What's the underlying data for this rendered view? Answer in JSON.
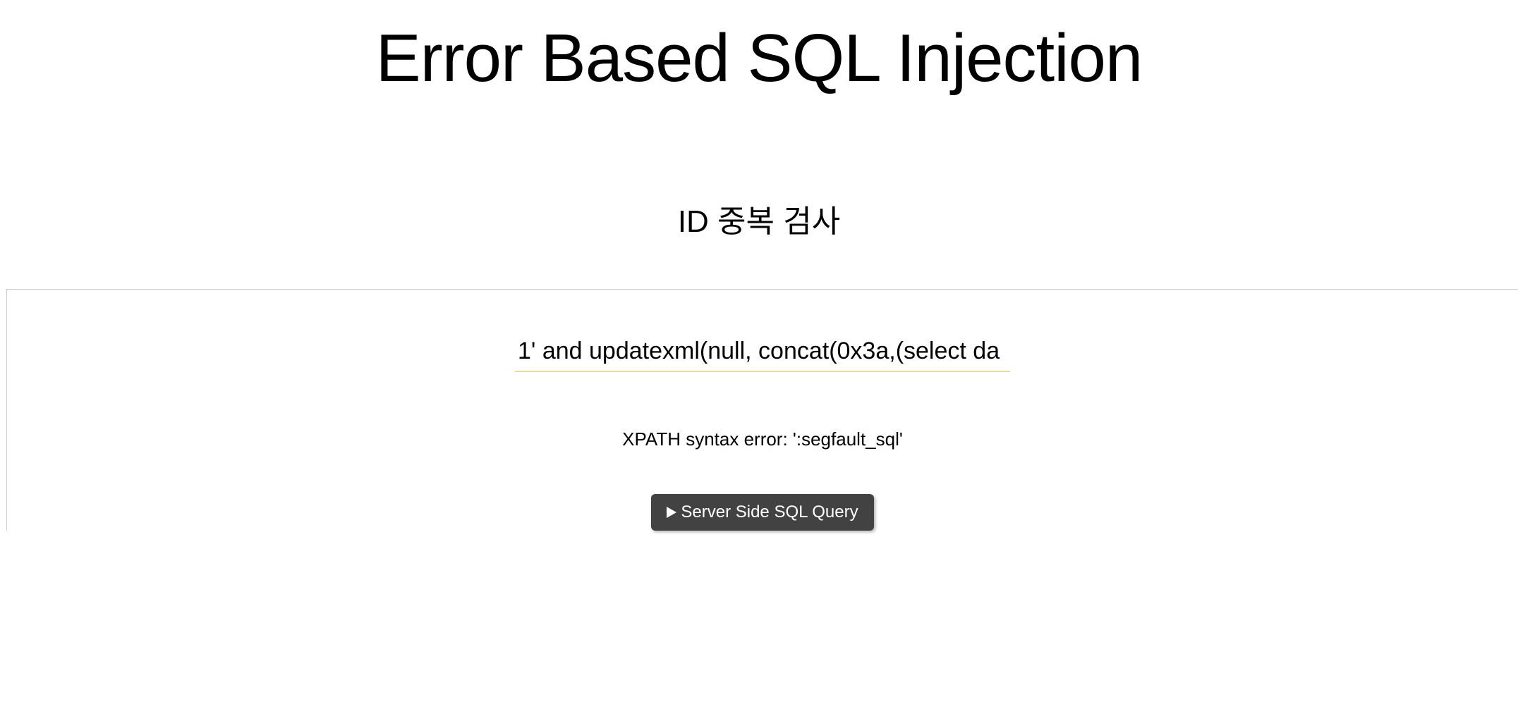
{
  "page": {
    "title": "Error Based SQL Injection",
    "subtitle": "ID 중복 검사"
  },
  "form": {
    "input_value": "1' and updatexml(null, concat(0x3a,(select da",
    "error_message": "XPATH syntax error: ':segfault_sql'",
    "button_label": "Server Side SQL Query"
  }
}
